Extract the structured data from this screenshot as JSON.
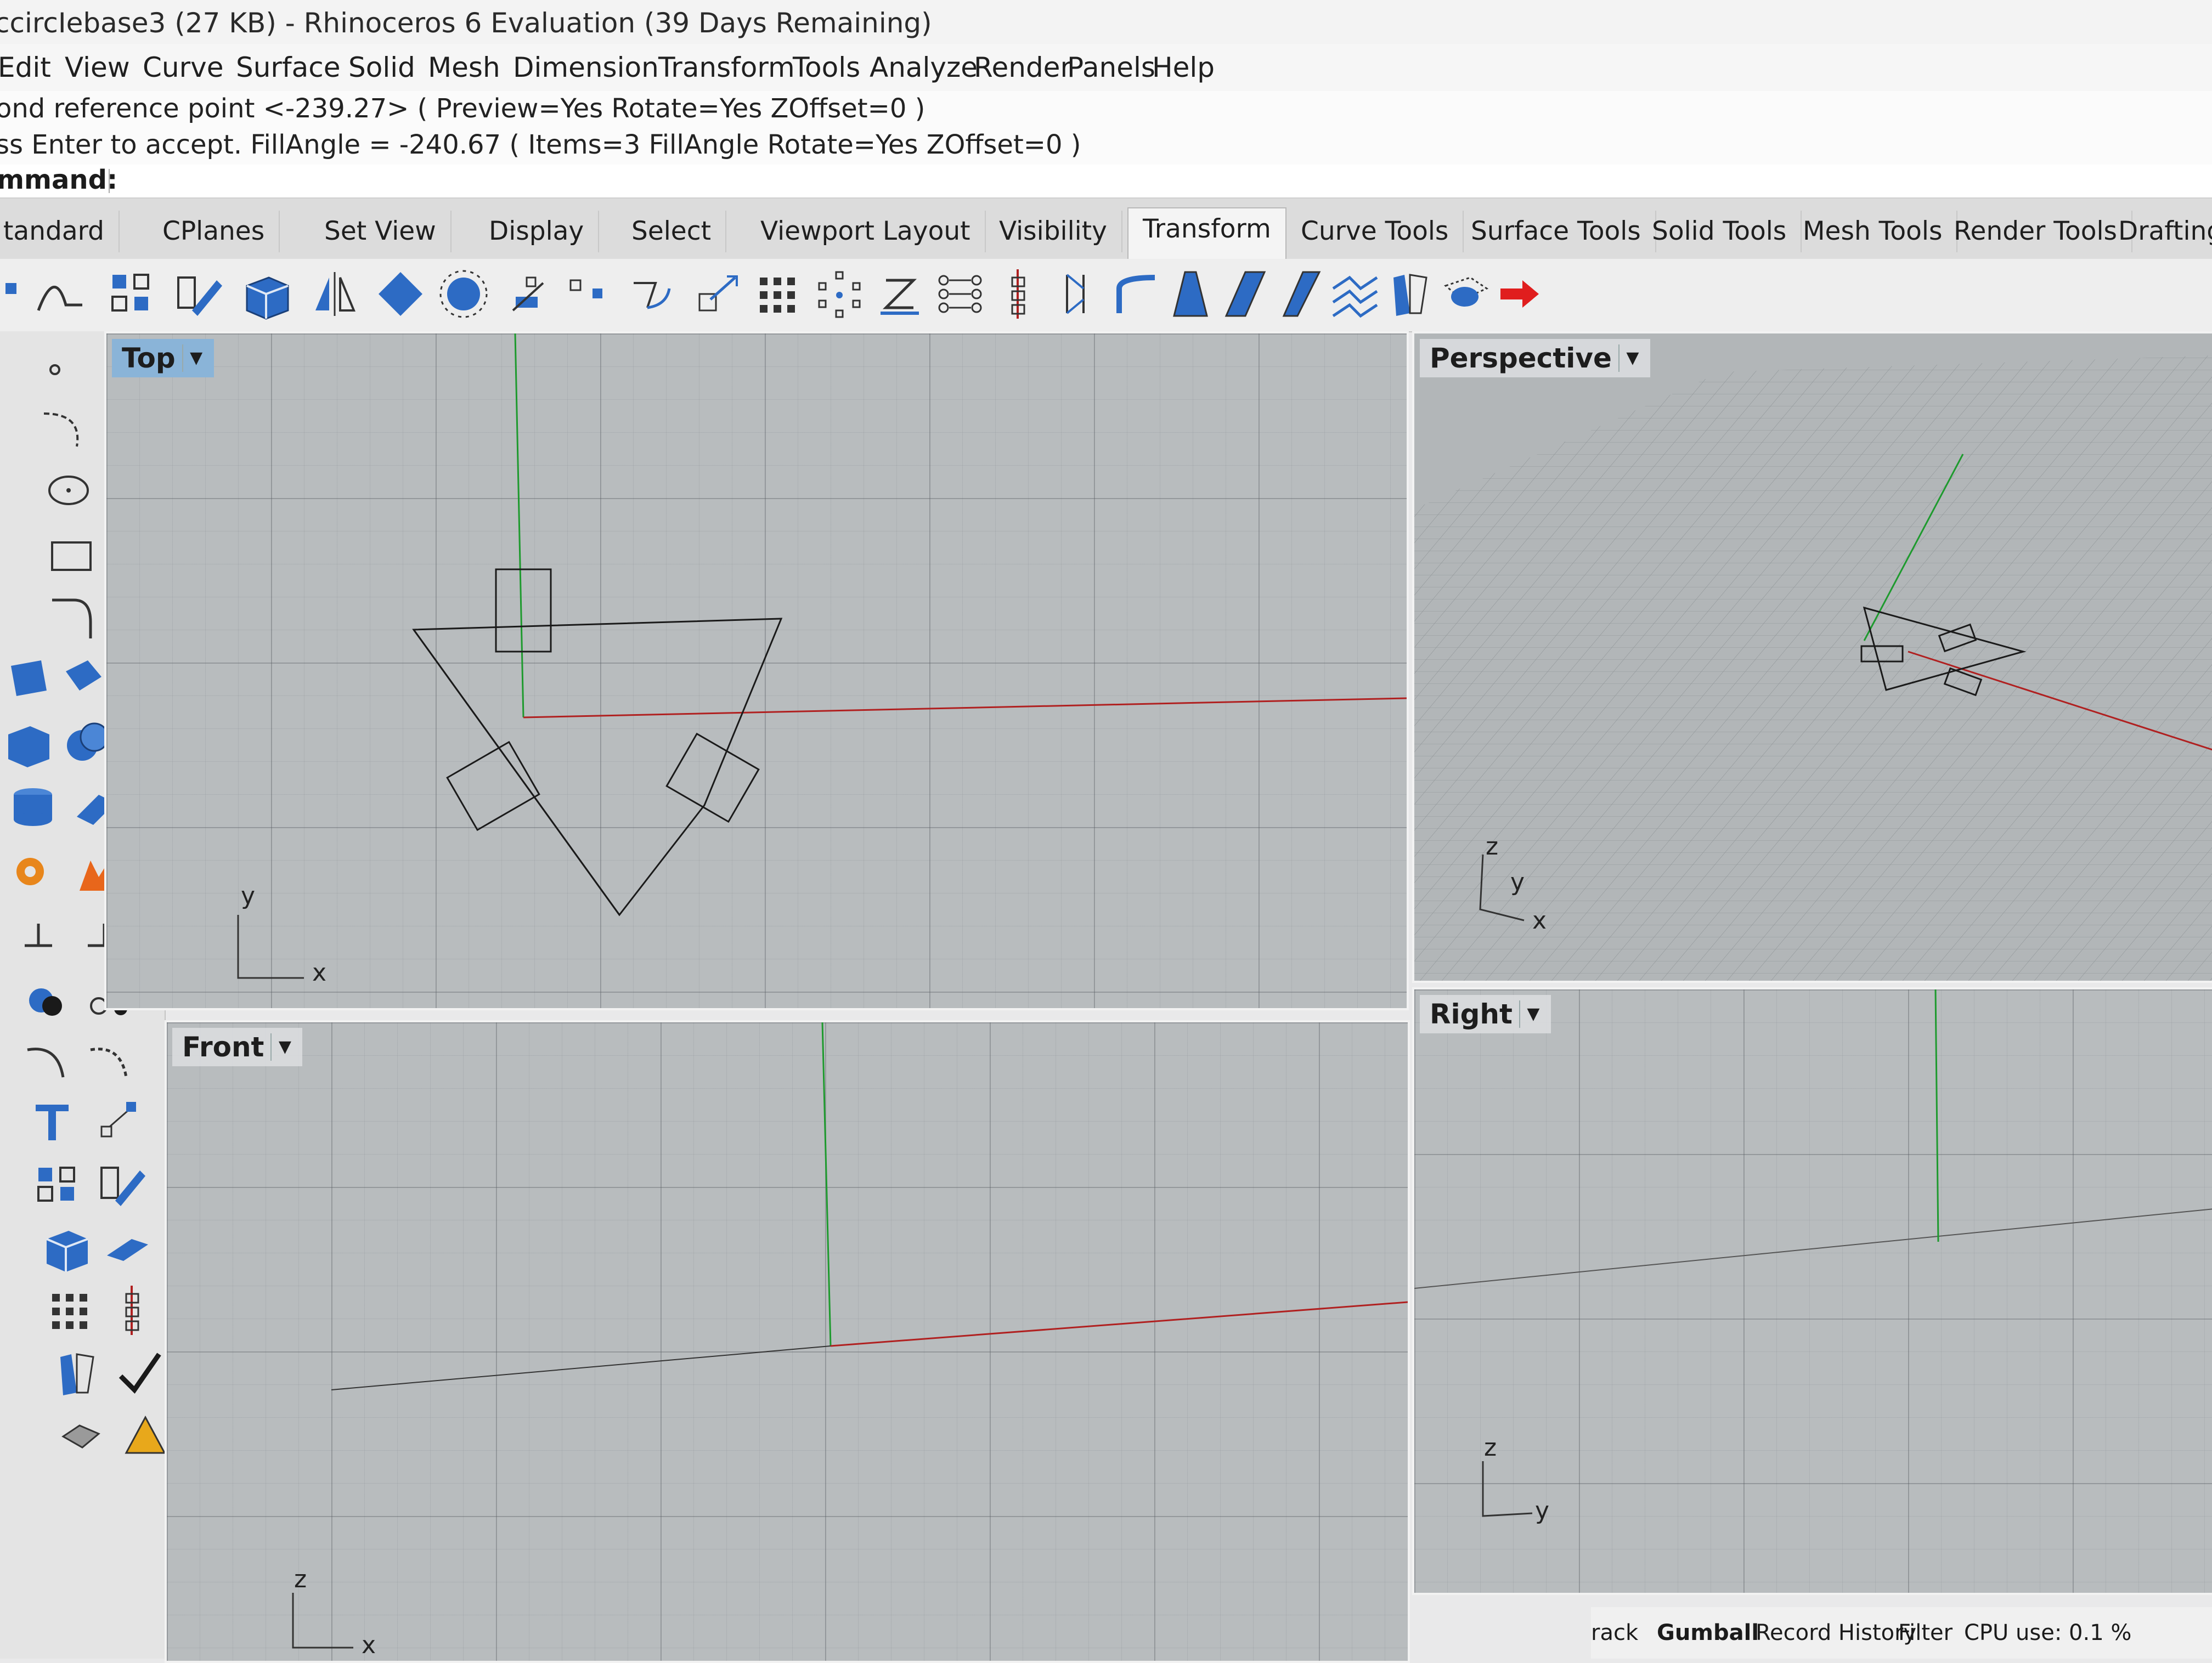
{
  "window": {
    "title": "ccircIebase3 (27 KB) - Rhinoceros 6 Evaluation (39 Days Remaining)"
  },
  "menu": {
    "items": [
      "Edit",
      "View",
      "Curve",
      "Surface",
      "Solid",
      "Mesh",
      "Dimension",
      "Transform",
      "Tools",
      "Analyze",
      "Render",
      "Panels",
      "Help"
    ]
  },
  "command_history": {
    "line1": "ond reference point <-239.27> ( Preview=Yes  Rotate=Yes  ZOffset=0 )",
    "line2": "ss Enter to accept. FillAngle = -240.67 ( Items=3  FillAngle  Rotate=Yes  ZOffset=0 )"
  },
  "command_line": {
    "prompt": "mmand:",
    "value": ""
  },
  "tabs": [
    "tandard",
    "CPlanes",
    "Set View",
    "Display",
    "Select",
    "Viewport Layout",
    "Visibility",
    "Transform",
    "Curve Tools",
    "Surface Tools",
    "Solid Tools",
    "Mesh Tools",
    "Render Tools",
    "Drafting"
  ],
  "active_tab": "Transform",
  "toolbar_icons": [
    "point-icon",
    "curve-icon",
    "group-icon",
    "edit-icon",
    "box-solid-icon",
    "mirror-icon",
    "plane-icon",
    "sphere-icon",
    "move-icon",
    "points-icon",
    "rotate-icon",
    "scale-icon",
    "array-icon",
    "polar-array-icon",
    "z-icon",
    "array-linear-icon",
    "align-icon",
    "orient-icon",
    "bend-icon",
    "taper-icon",
    "shear-icon",
    "twist-icon",
    "flow-icon",
    "smash-icon",
    "cage-icon",
    "red-arrow-icon"
  ],
  "viewports": {
    "top": {
      "label": "Top",
      "axis_x": "x",
      "axis_y": "y"
    },
    "perspective": {
      "label": "Perspective",
      "axis_x": "x",
      "axis_y": "y",
      "axis_z": "z"
    },
    "front": {
      "label": "Front",
      "axis_x": "x",
      "axis_z": "z"
    },
    "right": {
      "label": "Right",
      "axis_y": "y",
      "axis_z": "z"
    }
  },
  "colors": {
    "x_axis": "#b02020",
    "y_axis": "#1e9a2e",
    "active_viewport_label": "#8ab4d8",
    "geometry": "#1a1a1a"
  },
  "status": {
    "gumball": "Gumball",
    "track": "rack",
    "record_history": "Record History",
    "filter": "Filter",
    "cpu": "CPU use: 0.1 %"
  }
}
